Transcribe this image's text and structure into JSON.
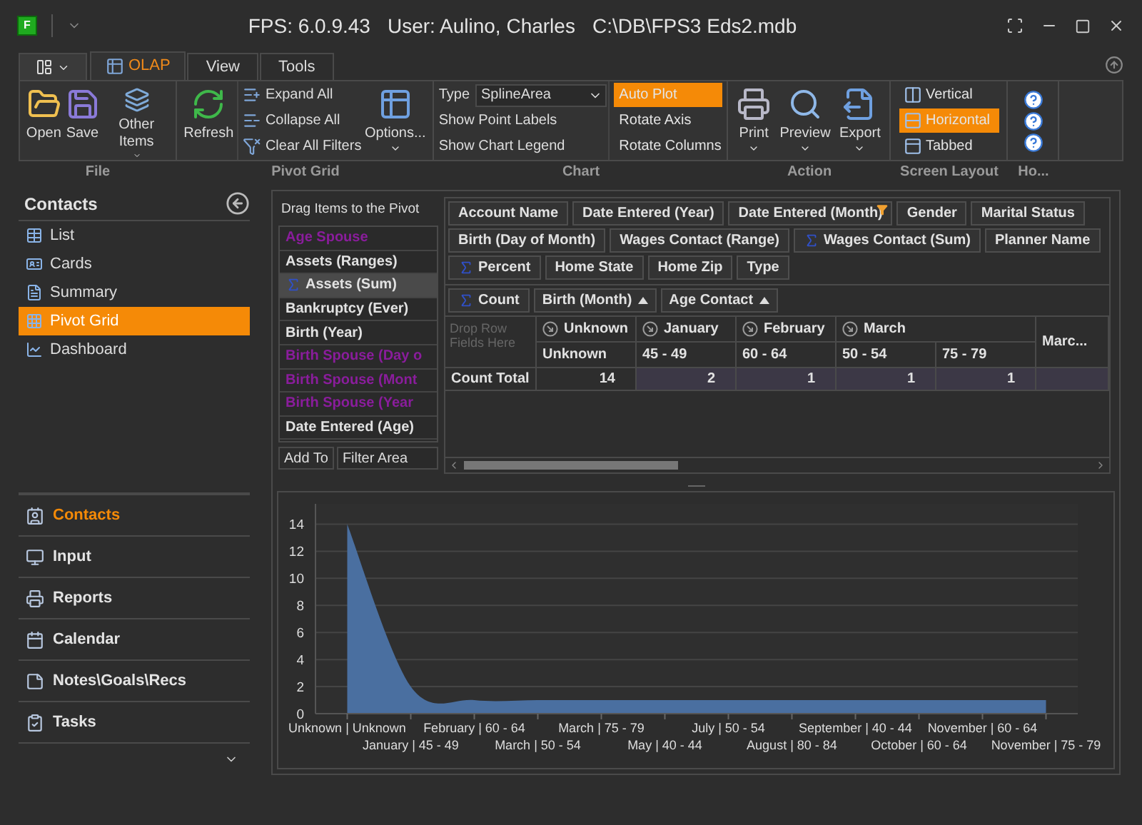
{
  "window": {
    "logo": "F",
    "title_parts": [
      "FPS: 6.0.9.43",
      "User: Aulino, Charles",
      "C:\\DB\\FPS3 Eds2.mdb"
    ]
  },
  "tabs": [
    {
      "label": "OLAP",
      "selected": true
    },
    {
      "label": "View",
      "selected": false
    },
    {
      "label": "Tools",
      "selected": false
    }
  ],
  "ribbon_groups": [
    {
      "label": "File",
      "items": [
        {
          "kind": "large",
          "label": "Open",
          "dropdown": false
        },
        {
          "kind": "large",
          "label": "Save",
          "dropdown": false
        },
        {
          "kind": "large",
          "label": "Other Items",
          "dropdown": true
        }
      ]
    },
    {
      "label": "Pivot Grid",
      "items": [
        {
          "kind": "large",
          "label": "Refresh",
          "dropdown": false
        },
        {
          "kind": "stack",
          "entries": [
            {
              "kind": "icon",
              "label": "Expand All"
            },
            {
              "kind": "icon",
              "label": "Collapse All"
            },
            {
              "kind": "icon",
              "label": "Clear All Filters"
            }
          ]
        },
        {
          "kind": "large",
          "label": "Options...",
          "dropdown": true
        }
      ]
    },
    {
      "label": "Chart",
      "items": [
        {
          "kind": "stack",
          "entries": [
            {
              "kind": "combo",
              "label": "Type",
              "value": "SplineArea"
            },
            {
              "kind": "plain",
              "label": "Show Point Labels"
            },
            {
              "kind": "plain",
              "label": "Show Chart Legend"
            }
          ]
        },
        {
          "kind": "stack",
          "entries": [
            {
              "kind": "toggle",
              "label": "Auto Plot",
              "selected": true
            },
            {
              "kind": "toggle",
              "label": "Rotate Axis",
              "selected": false
            },
            {
              "kind": "toggle",
              "label": "Rotate Columns",
              "selected": false
            }
          ]
        }
      ]
    },
    {
      "label": "Action",
      "items": [
        {
          "kind": "large",
          "label": "Print",
          "dropdown": true
        },
        {
          "kind": "large",
          "label": "Preview",
          "dropdown": true
        },
        {
          "kind": "large",
          "label": "Export",
          "dropdown": true
        }
      ]
    },
    {
      "label": "Screen Layout",
      "items": [
        {
          "kind": "stack",
          "entries": [
            {
              "kind": "layout",
              "label": "Vertical",
              "selected": false
            },
            {
              "kind": "layout",
              "label": "Horizontal",
              "selected": true
            },
            {
              "kind": "layout",
              "label": "Tabbed",
              "selected": false
            }
          ]
        }
      ]
    },
    {
      "label": "Ho...",
      "items": [
        {
          "kind": "stack",
          "entries": [
            {
              "kind": "help"
            },
            {
              "kind": "help"
            },
            {
              "kind": "help"
            }
          ]
        }
      ]
    }
  ],
  "sidebar": {
    "title": "Contacts",
    "items": [
      {
        "label": "List",
        "selected": false
      },
      {
        "label": "Cards",
        "selected": false
      },
      {
        "label": "Summary",
        "selected": false
      },
      {
        "label": "Pivot Grid",
        "selected": true
      },
      {
        "label": "Dashboard",
        "selected": false
      }
    ]
  },
  "nav": {
    "items": [
      {
        "label": "Contacts",
        "selected": true
      },
      {
        "label": "Input",
        "selected": false
      },
      {
        "label": "Reports",
        "selected": false
      },
      {
        "label": "Calendar",
        "selected": false
      },
      {
        "label": "Notes\\Goals\\Recs",
        "selected": false
      },
      {
        "label": "Tasks",
        "selected": false
      }
    ]
  },
  "field_list": {
    "header": "Drag Items to the Pivot",
    "items": [
      {
        "label": "Age Spouse",
        "kind": "dimension",
        "spouse": true,
        "selected": false
      },
      {
        "label": "Assets (Ranges)",
        "kind": "dimension",
        "spouse": false,
        "selected": false
      },
      {
        "label": "Assets (Sum)",
        "kind": "measure",
        "spouse": false,
        "selected": true
      },
      {
        "label": "Bankruptcy (Ever)",
        "kind": "dimension",
        "spouse": false,
        "selected": false
      },
      {
        "label": "Birth (Year)",
        "kind": "dimension",
        "spouse": false,
        "selected": false
      },
      {
        "label": "Birth Spouse (Day o",
        "kind": "dimension",
        "spouse": true,
        "selected": false
      },
      {
        "label": "Birth Spouse (Mont",
        "kind": "dimension",
        "spouse": true,
        "selected": false
      },
      {
        "label": "Birth Spouse (Year",
        "kind": "dimension",
        "spouse": true,
        "selected": false
      },
      {
        "label": "Date Entered (Age)",
        "kind": "dimension",
        "spouse": false,
        "selected": false
      }
    ],
    "add_to": "Add To",
    "target": "Filter Area"
  },
  "filter_rows": [
    [
      {
        "label": "Account Name",
        "kind": "dimension",
        "filtered": false
      },
      {
        "label": "Date Entered (Year)",
        "kind": "dimension",
        "filtered": false
      },
      {
        "label": "Date Entered (Month)",
        "kind": "dimension",
        "filtered": true
      },
      {
        "label": "Gender",
        "kind": "dimension",
        "filtered": false
      },
      {
        "label": "Marital Status",
        "kind": "dimension",
        "filtered": false
      }
    ],
    [
      {
        "label": "Birth (Day of Month)",
        "kind": "dimension",
        "filtered": false
      },
      {
        "label": "Wages Contact (Range)",
        "kind": "dimension",
        "filtered": false
      },
      {
        "label": "Wages Contact (Sum)",
        "kind": "measure",
        "filtered": false
      },
      {
        "label": "Planner Name",
        "kind": "dimension",
        "filtered": false
      }
    ],
    [
      {
        "label": "Percent",
        "kind": "measure",
        "filtered": false
      },
      {
        "label": "Home State",
        "kind": "dimension",
        "filtered": false
      },
      {
        "label": "Home Zip",
        "kind": "dimension",
        "filtered": false
      },
      {
        "label": "Type",
        "kind": "dimension",
        "filtered": false
      }
    ]
  ],
  "data_fields": [
    {
      "label": "Count",
      "kind": "measure"
    }
  ],
  "column_fields": [
    {
      "label": "Birth (Month)",
      "sort_ascending": true
    },
    {
      "label": "Age Contact",
      "sort_ascending": true
    }
  ],
  "row_drop_zone": {
    "placeholder": "Drop Row Fields Here"
  },
  "columns": [
    {
      "label": "Unknown",
      "kind": "group",
      "children": [
        {
          "label": "Unknown",
          "value": "14",
          "selected": false
        }
      ]
    },
    {
      "label": "January",
      "kind": "group",
      "children": [
        {
          "label": "45 - 49",
          "value": "2",
          "selected": true
        }
      ]
    },
    {
      "label": "February",
      "kind": "group",
      "children": [
        {
          "label": "60 - 64",
          "value": "1",
          "selected": true
        }
      ]
    },
    {
      "label": "March",
      "kind": "group",
      "children": [
        {
          "label": "50 - 54",
          "value": "1",
          "selected": true
        },
        {
          "label": "75 - 79",
          "value": "1",
          "selected": true
        }
      ]
    },
    {
      "label": "Marc...",
      "kind": "total",
      "selected": true
    }
  ],
  "row_total_label": "Count Total",
  "chart_data": {
    "type": "area",
    "categories": [
      "Unknown | Unknown",
      "January | 45 - 49",
      "February | 60 - 64",
      "March | 50 - 54",
      "March | 75 - 79",
      "May | 40 - 44",
      "July | 50 - 54",
      "August | 80 - 84",
      "September | 40 - 44",
      "October | 60 - 64",
      "November | 60 - 64",
      "November | 75 - 79"
    ],
    "series": [
      {
        "color": "#4a6fa0",
        "values": [
          14,
          2,
          1,
          1,
          1,
          1,
          1,
          1,
          1,
          1,
          1,
          1
        ]
      }
    ],
    "ylim": [
      0,
      15.5
    ],
    "yticks": [
      0,
      2,
      4,
      6,
      8,
      10,
      12,
      14
    ],
    "grid": true
  }
}
